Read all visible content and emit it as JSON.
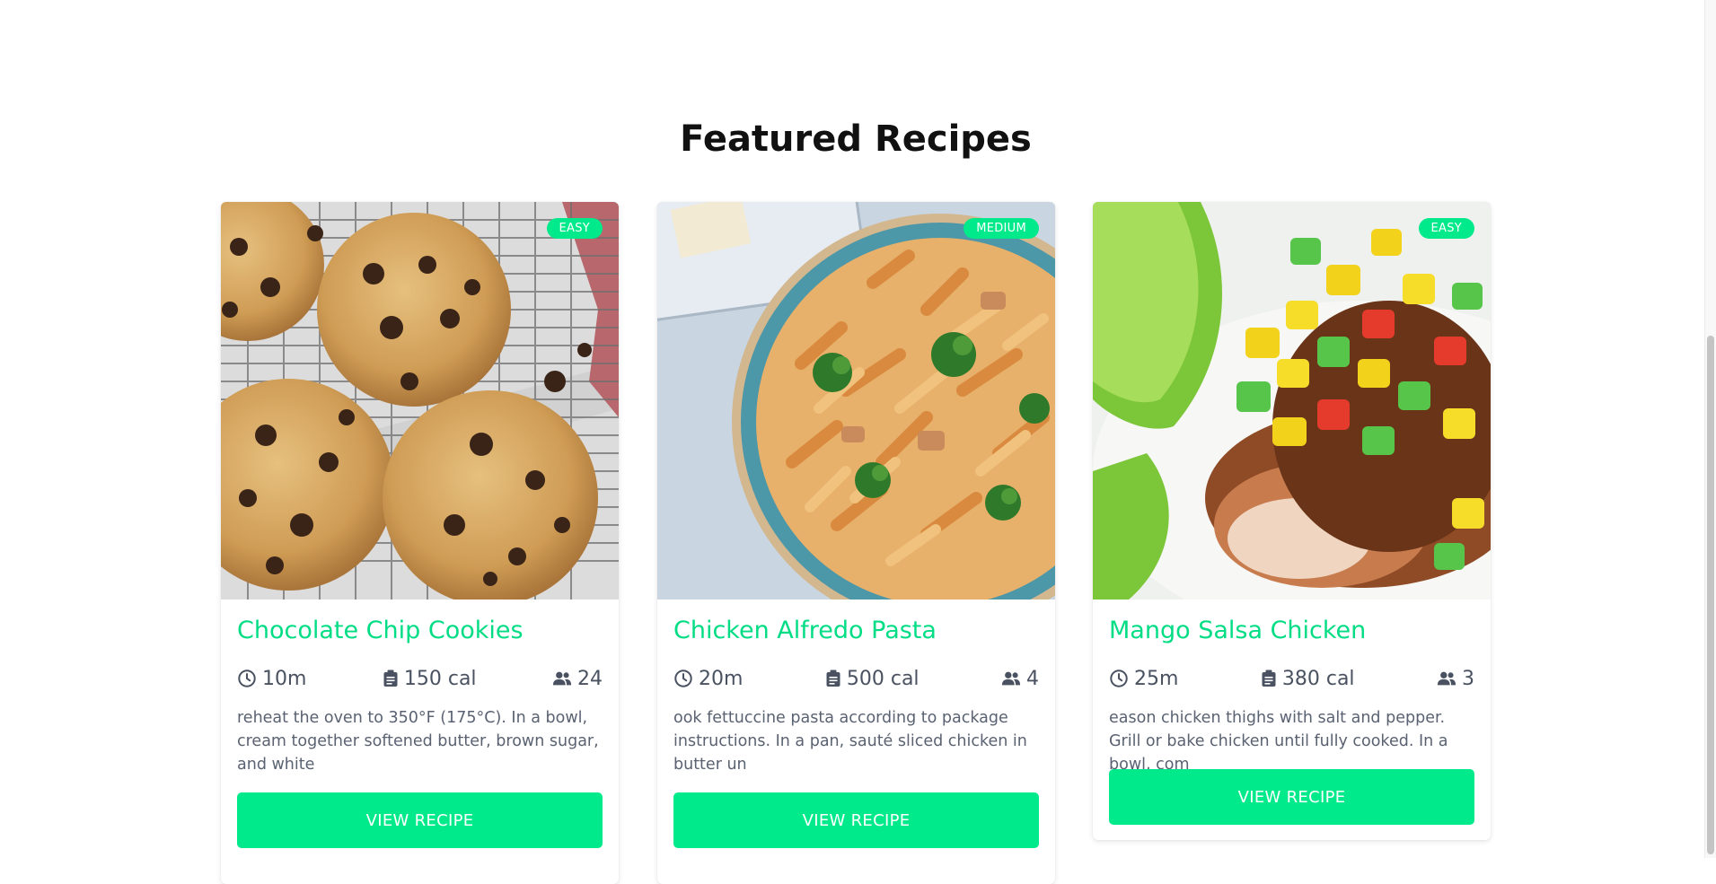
{
  "section": {
    "title": "Featured Recipes"
  },
  "recipes": [
    {
      "title": "Chocolate Chip Cookies",
      "difficulty": "EASY",
      "time": "10m",
      "calories": "150 cal",
      "servings": "24",
      "description": "reheat the oven to 350°F (175°C). In a bowl, cream together softened butter, brown sugar, and white",
      "button": "VIEW RECIPE",
      "image": "cookies-photo"
    },
    {
      "title": "Chicken Alfredo Pasta",
      "difficulty": "MEDIUM",
      "time": "20m",
      "calories": "500 cal",
      "servings": "4",
      "description": "ook fettuccine pasta according to package instructions. In a pan, sauté sliced chicken in butter un",
      "button": "VIEW RECIPE",
      "image": "pasta-photo"
    },
    {
      "title": "Mango Salsa Chicken",
      "difficulty": "EASY",
      "time": "25m",
      "calories": "380 cal",
      "servings": "3",
      "description": "eason chicken thighs with salt and pepper. Grill or bake chicken until fully cooked. In a bowl, com",
      "button": "VIEW RECIPE",
      "image": "mango-chicken-photo"
    }
  ],
  "icons": {
    "time": "clock-icon",
    "calories": "clipboard-icon",
    "servings": "people-icon"
  },
  "colors": {
    "accent": "#00e98a",
    "title": "#00dd84",
    "meta": "#4a5262"
  }
}
